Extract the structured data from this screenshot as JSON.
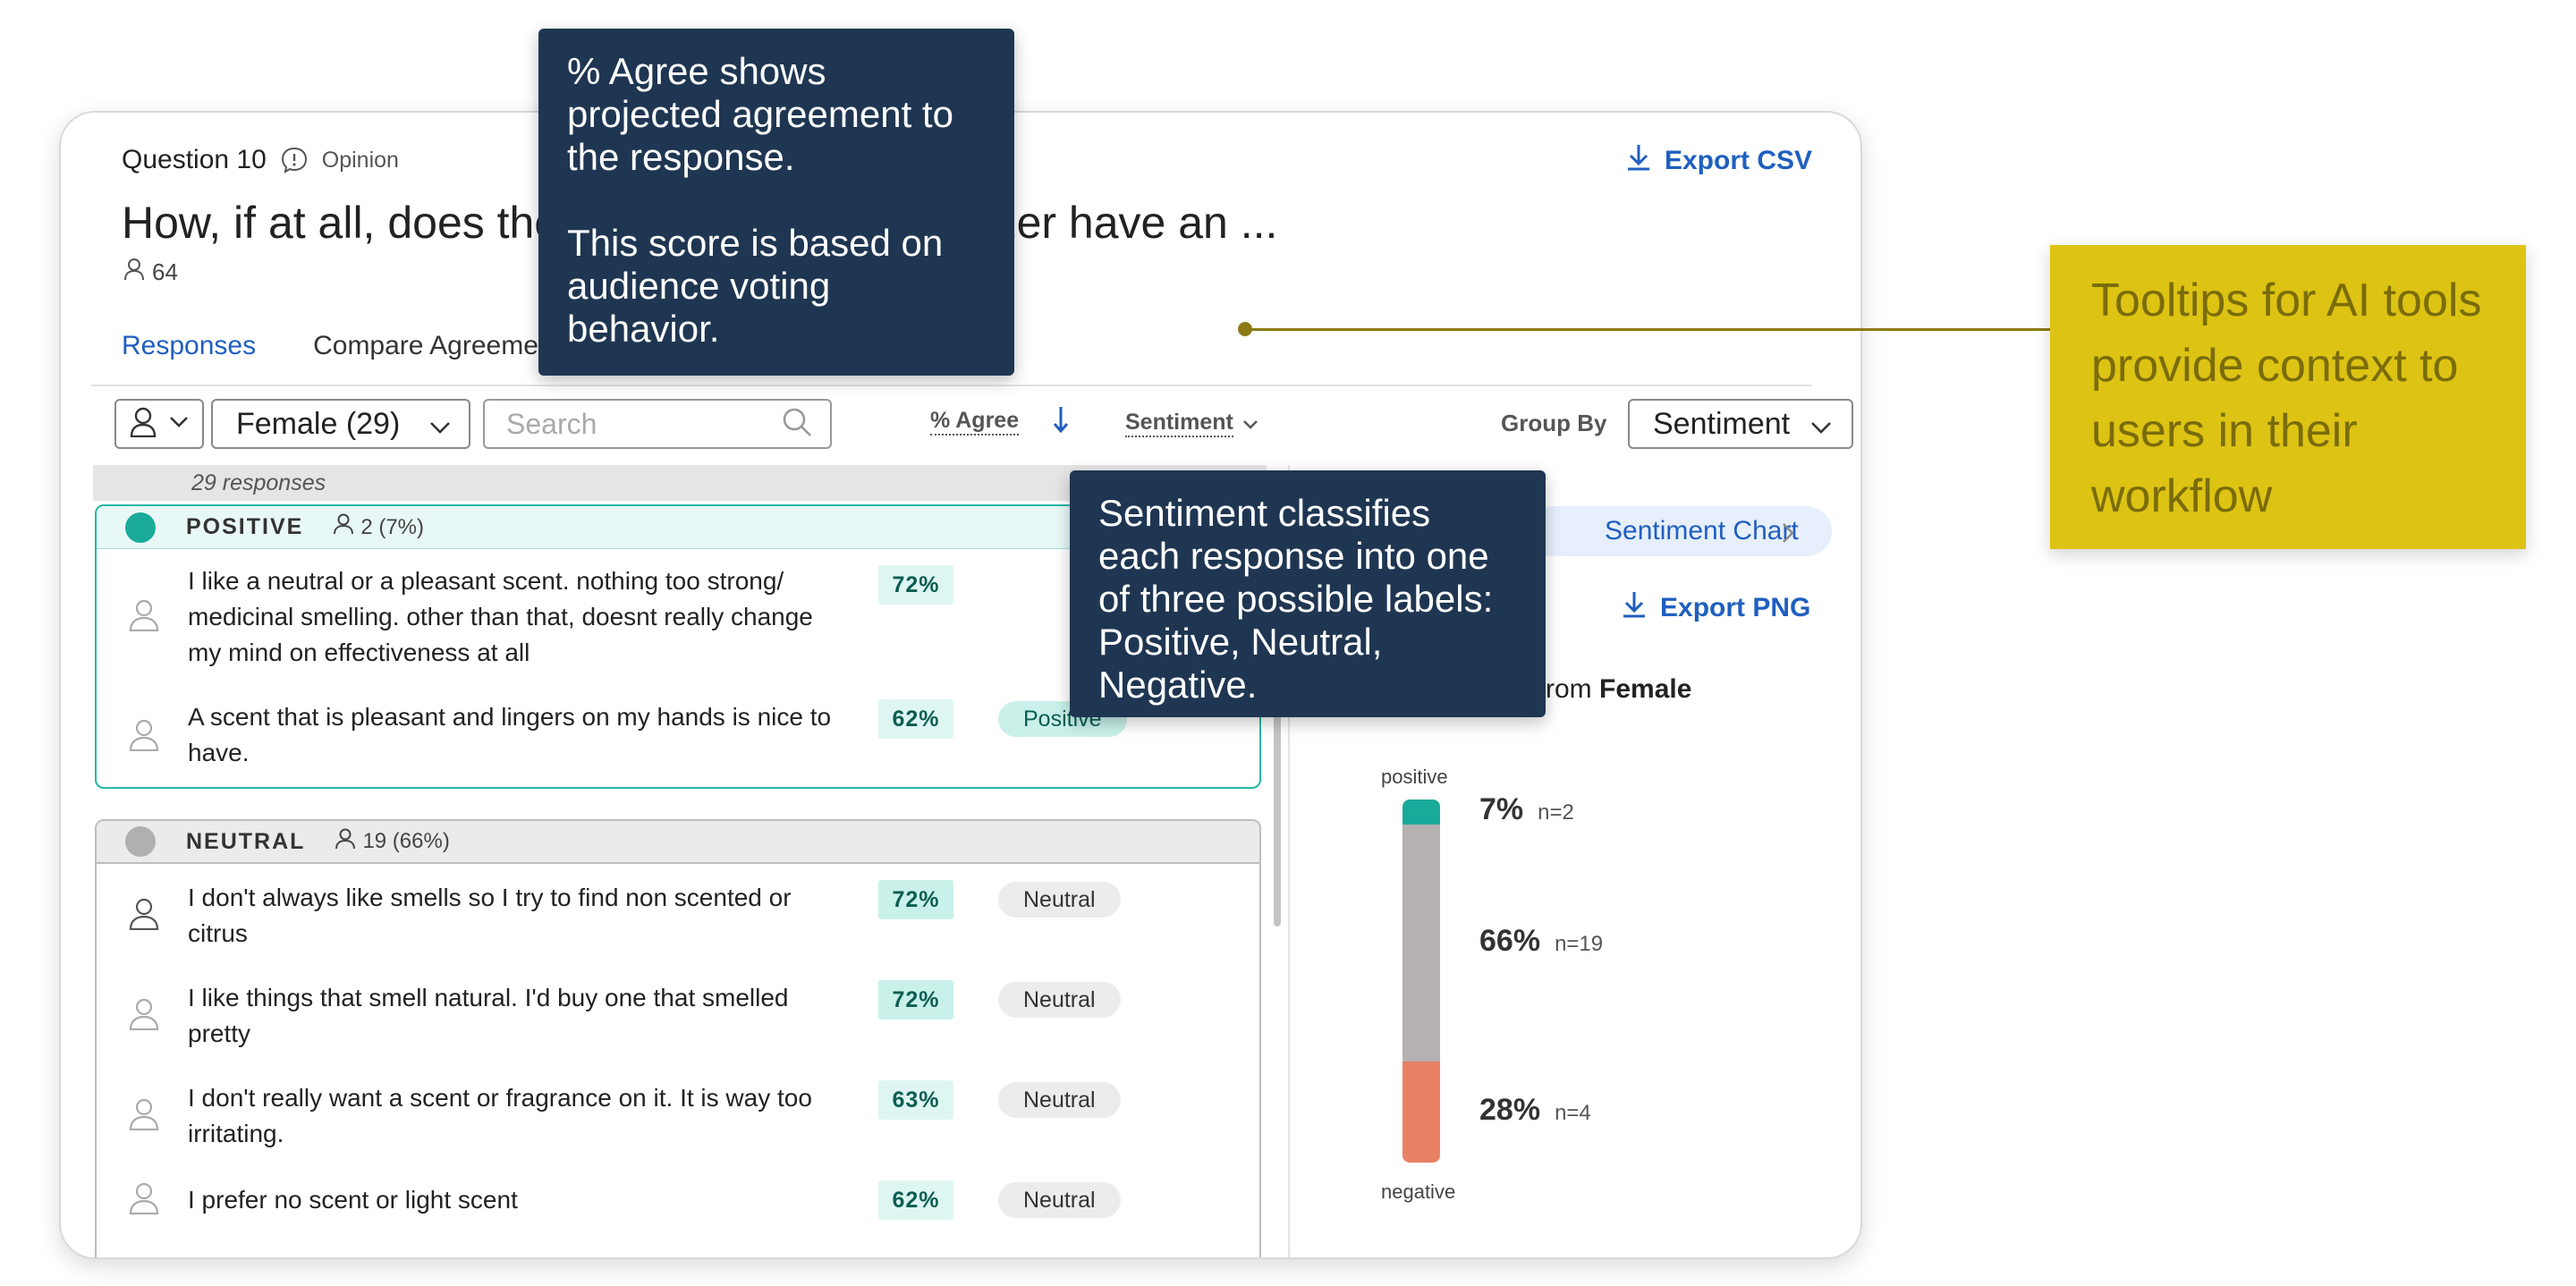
{
  "question": {
    "number_label": "Question 10",
    "type": "Opinion",
    "title": "How, if at all, does the scent of a hand sanitizer have an ...",
    "respondents": "64"
  },
  "export_csv": "Export CSV",
  "tabs": [
    {
      "label": "Responses",
      "active": true
    },
    {
      "label": "Compare Agreement",
      "active": false
    }
  ],
  "toolbar": {
    "segment": "Female (29)",
    "search_placeholder": "Search",
    "agree_col": "% Agree",
    "sentiment_col": "Sentiment",
    "group_by_label": "Group By",
    "group_by_value": "Sentiment"
  },
  "responses_count": "29 responses",
  "groups": {
    "positive": {
      "name": "POSITIVE",
      "count": "2 (7%)",
      "rows": [
        {
          "text": "I like a neutral or a pleasant scent. nothing too strong/ medicinal smelling. other than that, doesnt really change my mind on effectiveness at all",
          "agree": "72%",
          "sentiment": "Positive"
        },
        {
          "text": "A scent that is pleasant and lingers on my hands is nice to have.",
          "agree": "62%",
          "sentiment": "Positive"
        }
      ]
    },
    "neutral": {
      "name": "NEUTRAL",
      "count": "19 (66%)",
      "rows": [
        {
          "text": "I don't always like smells so I try to find non scented or citrus",
          "agree": "72%",
          "sentiment": "Neutral"
        },
        {
          "text": "I like things that smell natural. I'd buy one that smelled pretty",
          "agree": "72%",
          "sentiment": "Neutral"
        },
        {
          "text": "I don't really want a scent or fragrance on it. It is way too irritating.",
          "agree": "63%",
          "sentiment": "Neutral"
        },
        {
          "text": "I prefer no scent or light scent",
          "agree": "62%",
          "sentiment": "Neutral"
        }
      ]
    }
  },
  "right_panel": {
    "chart_tab": "Sentiment Chart",
    "export_png": "Export PNG",
    "from_prefix": "rom",
    "from_segment": "Female",
    "top_label": "positive",
    "bottom_label": "negative"
  },
  "chart_data": {
    "type": "bar",
    "categories": [
      "positive",
      "neutral",
      "negative"
    ],
    "values": [
      7,
      66,
      28
    ],
    "counts": [
      "n=2",
      "n=19",
      "n=4"
    ],
    "labels": [
      "7%",
      "66%",
      "28%"
    ],
    "colors": [
      "#1aaa9a",
      "#b5b0b2",
      "#e98064"
    ]
  },
  "tooltips": {
    "agree": "% Agree shows projected agreement to the response.\n\nThis score is based on audience voting behavior.",
    "sentiment": "Sentiment classifies each response into one of three possible labels: Positive, Neutral, Negative."
  },
  "annotation": "Tooltips for AI tools provide context to users in their workflow",
  "colors": {
    "accent": "#1f5fbf",
    "positive": "#1aaa9a",
    "neutral": "#b5b0b2",
    "negative": "#e98064",
    "tooltip_bg": "#1f3652",
    "annotation_bg": "#ddc313"
  }
}
